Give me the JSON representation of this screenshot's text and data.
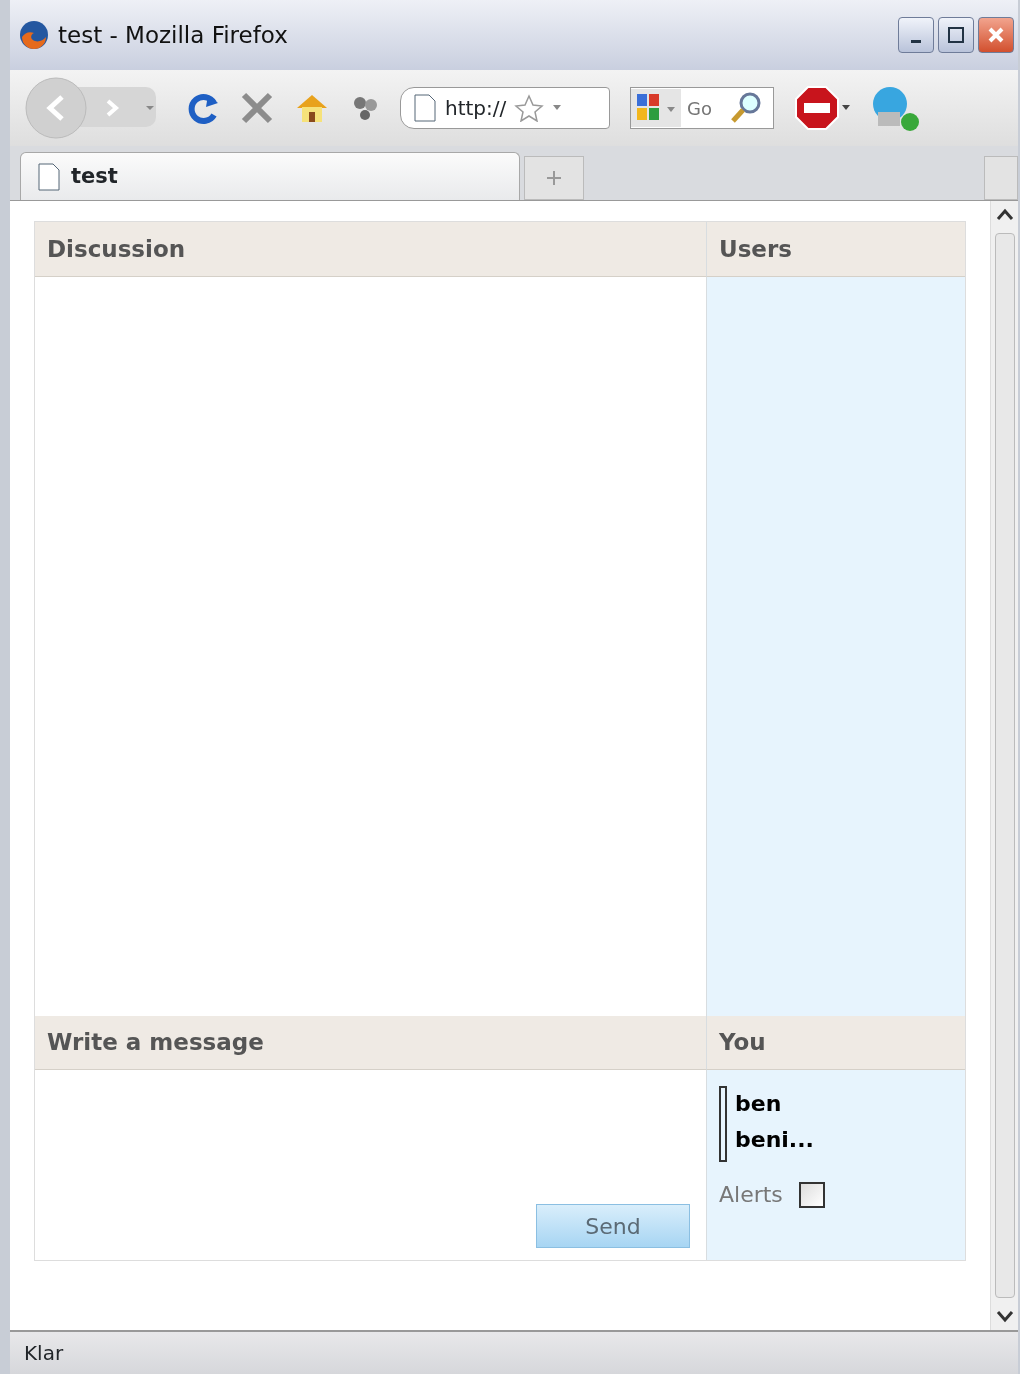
{
  "window": {
    "title": "test - Mozilla Firefox"
  },
  "toolbar": {
    "address": "http://",
    "search": {
      "placeholder": "Go"
    }
  },
  "tabs": [
    {
      "label": "test",
      "selected": true
    }
  ],
  "chat": {
    "discussion_header": "Discussion",
    "users_header": "Users",
    "compose_header": "Write a message",
    "you_header": "You",
    "send_button": "Send",
    "you_names": [
      "ben",
      "beni..."
    ],
    "alerts": {
      "label": "Alerts",
      "checked": false
    }
  },
  "status_bar": "Klar"
}
